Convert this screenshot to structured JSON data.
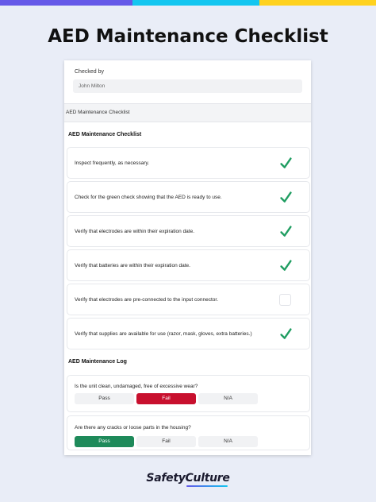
{
  "page": {
    "title": "AED Maintenance Checklist"
  },
  "form": {
    "checked_by": {
      "label": "Checked by",
      "value": "John Milton"
    },
    "section_band": "AED Maintenance Checklist",
    "checklist_heading": "AED Maintenance Checklist",
    "items": [
      {
        "text": "Inspect frequently, as necessary.",
        "checked": true
      },
      {
        "text": "Check for the green check showing that the AED is ready to use.",
        "checked": true
      },
      {
        "text": "Verify that electrodes are within their expiration date.",
        "checked": true
      },
      {
        "text": "Verify that batteries are within their expiration date.",
        "checked": true
      },
      {
        "text": "Verify that electrodes are pre-connected to the input connector.",
        "checked": false
      },
      {
        "text": "Verify that supplies are available for use (razor, mask, gloves, extra batteries.)",
        "checked": true
      }
    ],
    "log_heading": "AED Maintenance Log",
    "log": [
      {
        "question": "Is the unit clean, undamaged, free of excessive wear?",
        "options": [
          "Pass",
          "Fail",
          "N/A"
        ],
        "selected": "Fail"
      },
      {
        "question": "Are there any cracks or loose parts in the housing?",
        "options": [
          "Pass",
          "Fail",
          "N/A"
        ],
        "selected": "Pass"
      }
    ]
  },
  "brand": {
    "name": "SafetyCulture"
  },
  "colors": {
    "check_green": "#1f9d61",
    "fail_red": "#c8102e",
    "pass_green": "#1e8a5a",
    "accent_purple": "#6559e8",
    "accent_cyan": "#14c6f0",
    "accent_yellow": "#ffd21f"
  },
  "icons": {
    "checked": "checkmark-icon",
    "unchecked": "empty-checkbox"
  }
}
